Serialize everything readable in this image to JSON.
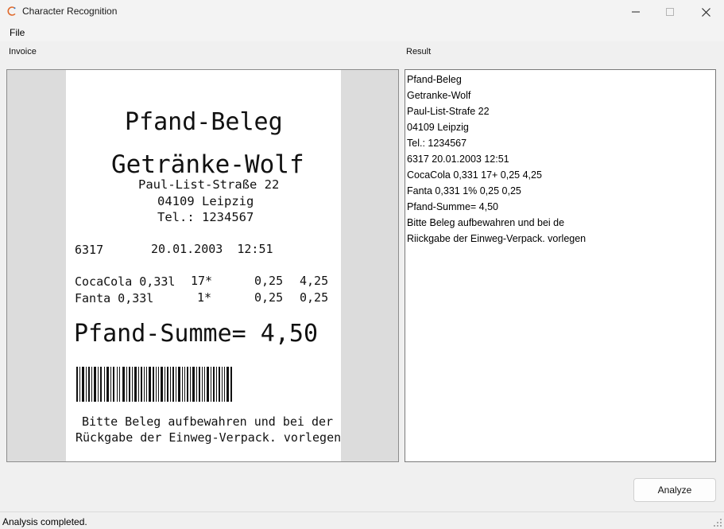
{
  "window": {
    "title": "Character Recognition"
  },
  "menu": {
    "file": "File"
  },
  "panels": {
    "invoice_label": "Invoice",
    "result_label": "Result"
  },
  "receipt": {
    "title": "Pfand-Beleg",
    "store": "Getränke-Wolf",
    "street": "Paul-List-Straße 22",
    "city": "04109 Leipzig",
    "phone": "Tel.: 1234567",
    "number": "6317",
    "datetime": "20.01.2003  12:51",
    "items": [
      {
        "name": "CocaCola 0,33l",
        "qty": "17*",
        "price": "0,25",
        "total": "4,25"
      },
      {
        "name": "Fanta 0,33l",
        "qty": "1*",
        "price": "0,25",
        "total": "0,25"
      }
    ],
    "sum": "Pfand-Summe= 4,50",
    "footer1": "Bitte Beleg aufbewahren und bei der",
    "footer2": "Rückgabe der Einweg-Verpack. vorlegen"
  },
  "result": {
    "lines": [
      "Pfand-Beleg",
      "Getranke-Wolf",
      "Paul-List-Strafe 22",
      "04109 Leipzig",
      "Tel.: 1234567",
      "6317 20.01.2003 12:51",
      "CocaCola 0,331 17+ 0,25 4,25",
      "Fanta 0,331 1% 0,25 0,25",
      "Pfand-Summe= 4,50",
      "Bitte Beleg aufbewahren und bei de",
      "Riickgabe der Einweg-Verpack. vorlegen"
    ]
  },
  "actions": {
    "analyze_label": "Analyze"
  },
  "status": {
    "text": "Analysis completed."
  }
}
